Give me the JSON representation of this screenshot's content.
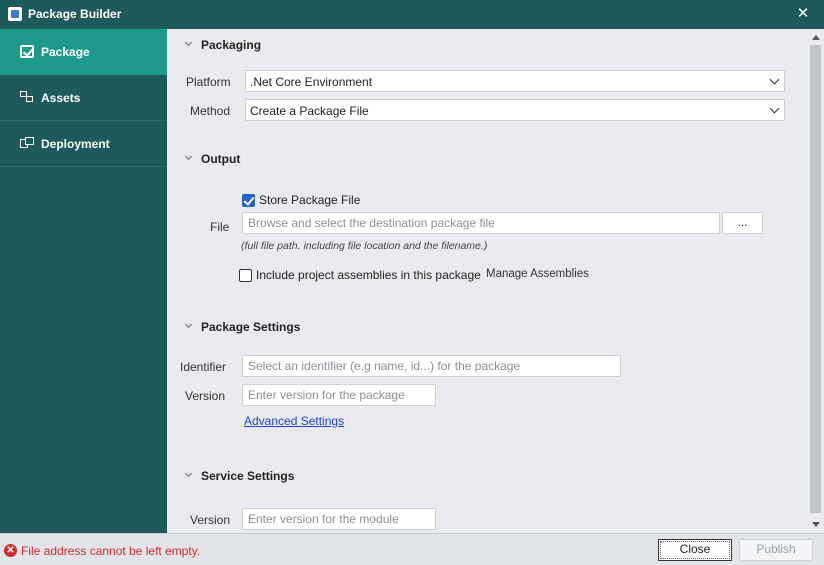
{
  "window": {
    "title": "Package Builder",
    "icon": "package-builder-icon",
    "close_icon": "close-icon"
  },
  "sidebar": {
    "items": [
      {
        "label": "Package",
        "icon": "package-check-icon",
        "active": true
      },
      {
        "label": "Assets",
        "icon": "assets-icon",
        "active": false
      },
      {
        "label": "Deployment",
        "icon": "deployment-icon",
        "active": false
      }
    ],
    "background": "#1e5a5a",
    "active_color": "#1e9a8a"
  },
  "packaging": {
    "heading": "Packaging",
    "platform_label": "Platform",
    "platform_value": ".Net Core Environment",
    "method_label": "Method",
    "method_value": "Create a Package File"
  },
  "output": {
    "heading": "Output",
    "store_label": "Store Package File",
    "store_checked": true,
    "file_label": "File",
    "file_placeholder": "Browse and select the destination package file",
    "file_value": "",
    "browse_label": "...",
    "hint": "(full file path. including file location and the filename.)",
    "include_label": "Include project assemblies in this package",
    "include_checked": false,
    "manage_label": "Manage Assemblies"
  },
  "package_settings": {
    "heading": "Package Settings",
    "identifier_label": "Identifier",
    "identifier_placeholder": "Select an identifier (e.g name, id...) for the package",
    "version_label": "Version",
    "version_placeholder": "Enter version for the package",
    "advanced_link": "Advanced Settings"
  },
  "service_settings": {
    "heading": "Service Settings",
    "version_label": "Version",
    "version_placeholder": "Enter version for the module"
  },
  "footer": {
    "error_text": "File address cannot be left empty.",
    "error_icon": "error-circle-icon",
    "error_color": "#d42b2b",
    "close_label": "Close",
    "publish_label": "Publish",
    "publish_enabled": false
  }
}
